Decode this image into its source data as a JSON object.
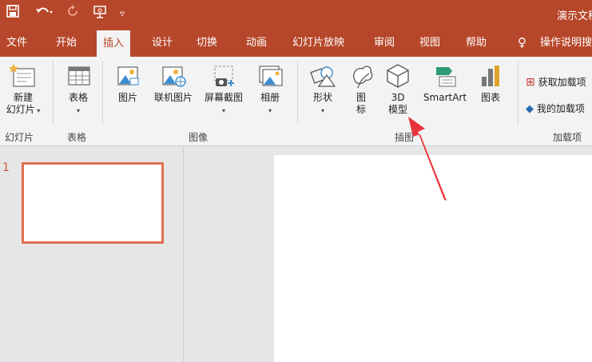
{
  "title_bar": {
    "doc_title": "演示文稿"
  },
  "tabs": [
    "文件",
    "开始",
    "插入",
    "设计",
    "切换",
    "动画",
    "幻灯片放映",
    "审阅",
    "视图",
    "帮助"
  ],
  "tell_me": "操作说明搜索",
  "ribbon": {
    "slides_group": {
      "new_slide": [
        "新建",
        "幻灯片"
      ],
      "label": "幻灯片"
    },
    "tables_group": {
      "table": "表格",
      "label": "表格"
    },
    "images_group": {
      "pictures": "图片",
      "online_pictures": "联机图片",
      "screenshot": "屏幕截图",
      "album": "相册",
      "label": "图像"
    },
    "illustrations_group": {
      "shapes": "形状",
      "icons": [
        "图",
        "标"
      ],
      "model3d": [
        "3D",
        "模型"
      ],
      "smartart": "SmartArt",
      "chart": "图表",
      "label": "插图"
    },
    "addins_group": {
      "get_addins": "获取加载项",
      "my_addins": "我的加载项",
      "label": "加载项"
    }
  },
  "slide_panel": {
    "slide_number": "1"
  },
  "colors": {
    "brand": "#b7472a",
    "thumb_border": "#e0704f",
    "arrow": "#e8333a"
  }
}
